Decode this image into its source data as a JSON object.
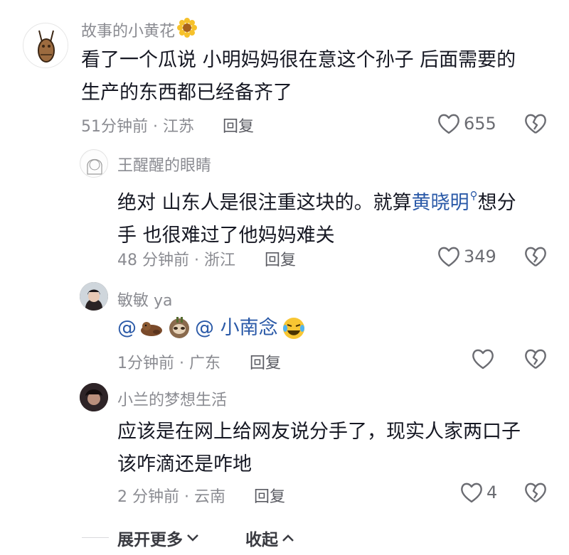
{
  "comments": [
    {
      "author": "故事的小黄花",
      "lines": [
        "看了一个瓜说 小明妈妈很在意这个孙子 后面需要的",
        "生产的东西都已经备齐了"
      ],
      "meta": "51分钟前 · 江苏",
      "reply_label": "回复",
      "likes": "655"
    },
    {
      "author": "王醒醒的眼睛",
      "line1_pre": "绝对 山东人是很注重这块的。就算",
      "line1_link": "黄晓明",
      "line1_post": "想分",
      "line2": "手 也很难过了他妈妈难关",
      "meta": "48 分钟前 · 浙江",
      "reply_label": "回复",
      "likes": "349"
    },
    {
      "author": "敏敏 ya",
      "mention_prefix": "@",
      "mention2": "@ 小南念",
      "meta": "1分钟前 · 广东",
      "reply_label": "回复",
      "likes": ""
    },
    {
      "author": "小兰的梦想生活",
      "lines": [
        "应该是在网上给网友说分手了，现实人家两口子",
        "该咋滴还是咋地"
      ],
      "meta": "2 分钟前 · 云南",
      "reply_label": "回复",
      "likes": "4"
    }
  ],
  "footer": {
    "expand_label": "展开更多",
    "collapse_label": "收起"
  },
  "icons": {
    "like": "heart-outline-icon",
    "dislike": "broken-heart-icon",
    "search": "search-icon",
    "expand": "chevron-down-icon",
    "collapse": "chevron-up-icon"
  },
  "colors": {
    "link": "#2b5aa8",
    "meta": "#8a8b91",
    "text": "#161823"
  }
}
